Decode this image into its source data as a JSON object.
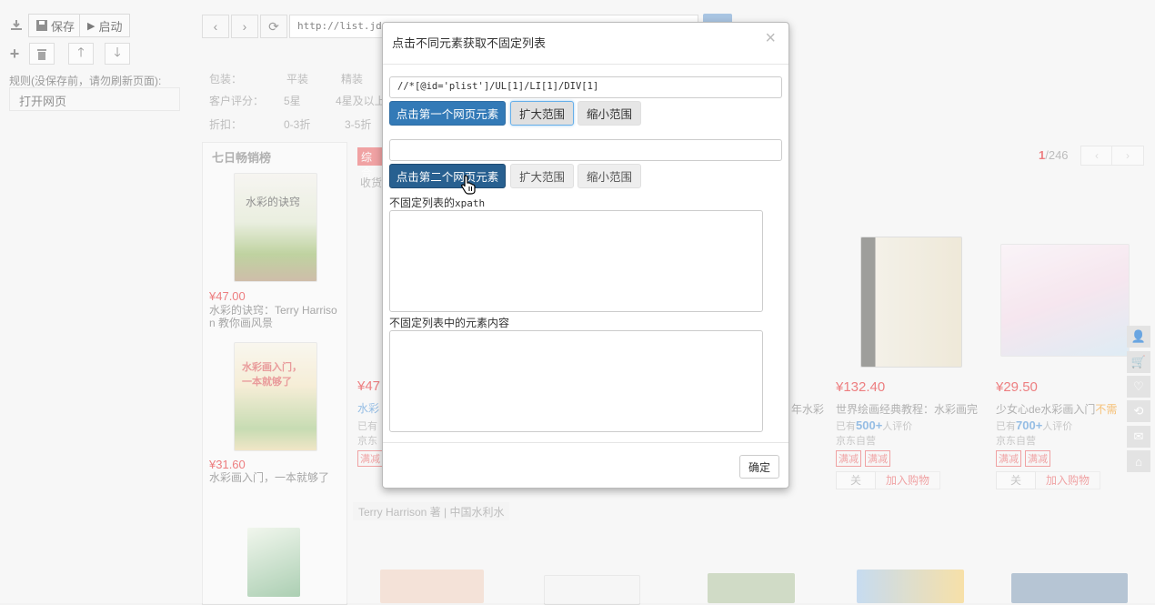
{
  "toolbar": {
    "save_label": "保存",
    "start_label": "启动",
    "url": "http://list.jd.c"
  },
  "rule": {
    "label": "规则(没保存前，请勿刷新页面):",
    "open_page": "打开网页"
  },
  "filters": {
    "row1": [
      "包装：",
      "平装",
      "精装"
    ],
    "rating_label": "客户评分：",
    "rating_opts": [
      "5星",
      "4星及以上"
    ],
    "discount_label": "折扣：",
    "discount_opts": [
      "0-3折",
      "3-5折"
    ]
  },
  "ranking": {
    "title": "七日畅销榜",
    "items": [
      {
        "price": "¥47.00",
        "name_line1": "水彩的诀窍：Terry Harriso",
        "name_line2": "n 教你画风景",
        "cover_text": "水彩的诀窍"
      },
      {
        "price": "¥31.60",
        "name_line1": "水彩画入门，一本就够了",
        "name_line2": "",
        "cover_text": "水彩画入门，一本就够了"
      }
    ]
  },
  "main": {
    "tab_label": "综合",
    "sub_label": "收货",
    "pager_current": "1",
    "pager_total": "/246",
    "partial_price": "¥47",
    "partial_name": "水彩",
    "partial_status": "已有",
    "partial_shop": "京东",
    "partial_tag": "满减",
    "partial_name_mid": "年水彩",
    "products": [
      {
        "price": "¥132.40",
        "name": "世界绘画经典教程：水彩画完",
        "comment_prefix": "已有",
        "comment_count": "500+",
        "comment_suffix": "人评价",
        "shop": "京东自营",
        "tags": [
          "满减",
          "满减"
        ],
        "follow": "关",
        "cart": "加入购物"
      },
      {
        "price": "¥29.50",
        "name": "少女心de水彩画入门",
        "name_extra": "不需",
        "comment_prefix": "已有",
        "comment_count": "700+",
        "comment_suffix": "人评价",
        "shop": "京东自营",
        "tags": [
          "满减",
          "满减"
        ],
        "follow": "关",
        "cart": "加入购物"
      }
    ],
    "author_line": "Terry Harrison 著 | 中国水利水"
  },
  "modal": {
    "title": "点击不同元素获取不固定列表",
    "xpath1": "//*[@id='plist']/UL[1]/LI[1]/DIV[1]",
    "xpath2": "",
    "btn_first": "点击第一个网页元素",
    "btn_second": "点击第二个网页元素",
    "expand": "扩大范围",
    "shrink": "缩小范围",
    "label_xpath_prefix": "不固定列表的",
    "label_xpath_mono": "xpath",
    "label_content": "不固定列表中的元素内容",
    "xpath_result": "",
    "content_result": "",
    "ok": "确定",
    "close": "×"
  },
  "colors": {
    "primary": "#337ab7",
    "price_red": "#e4393c"
  }
}
